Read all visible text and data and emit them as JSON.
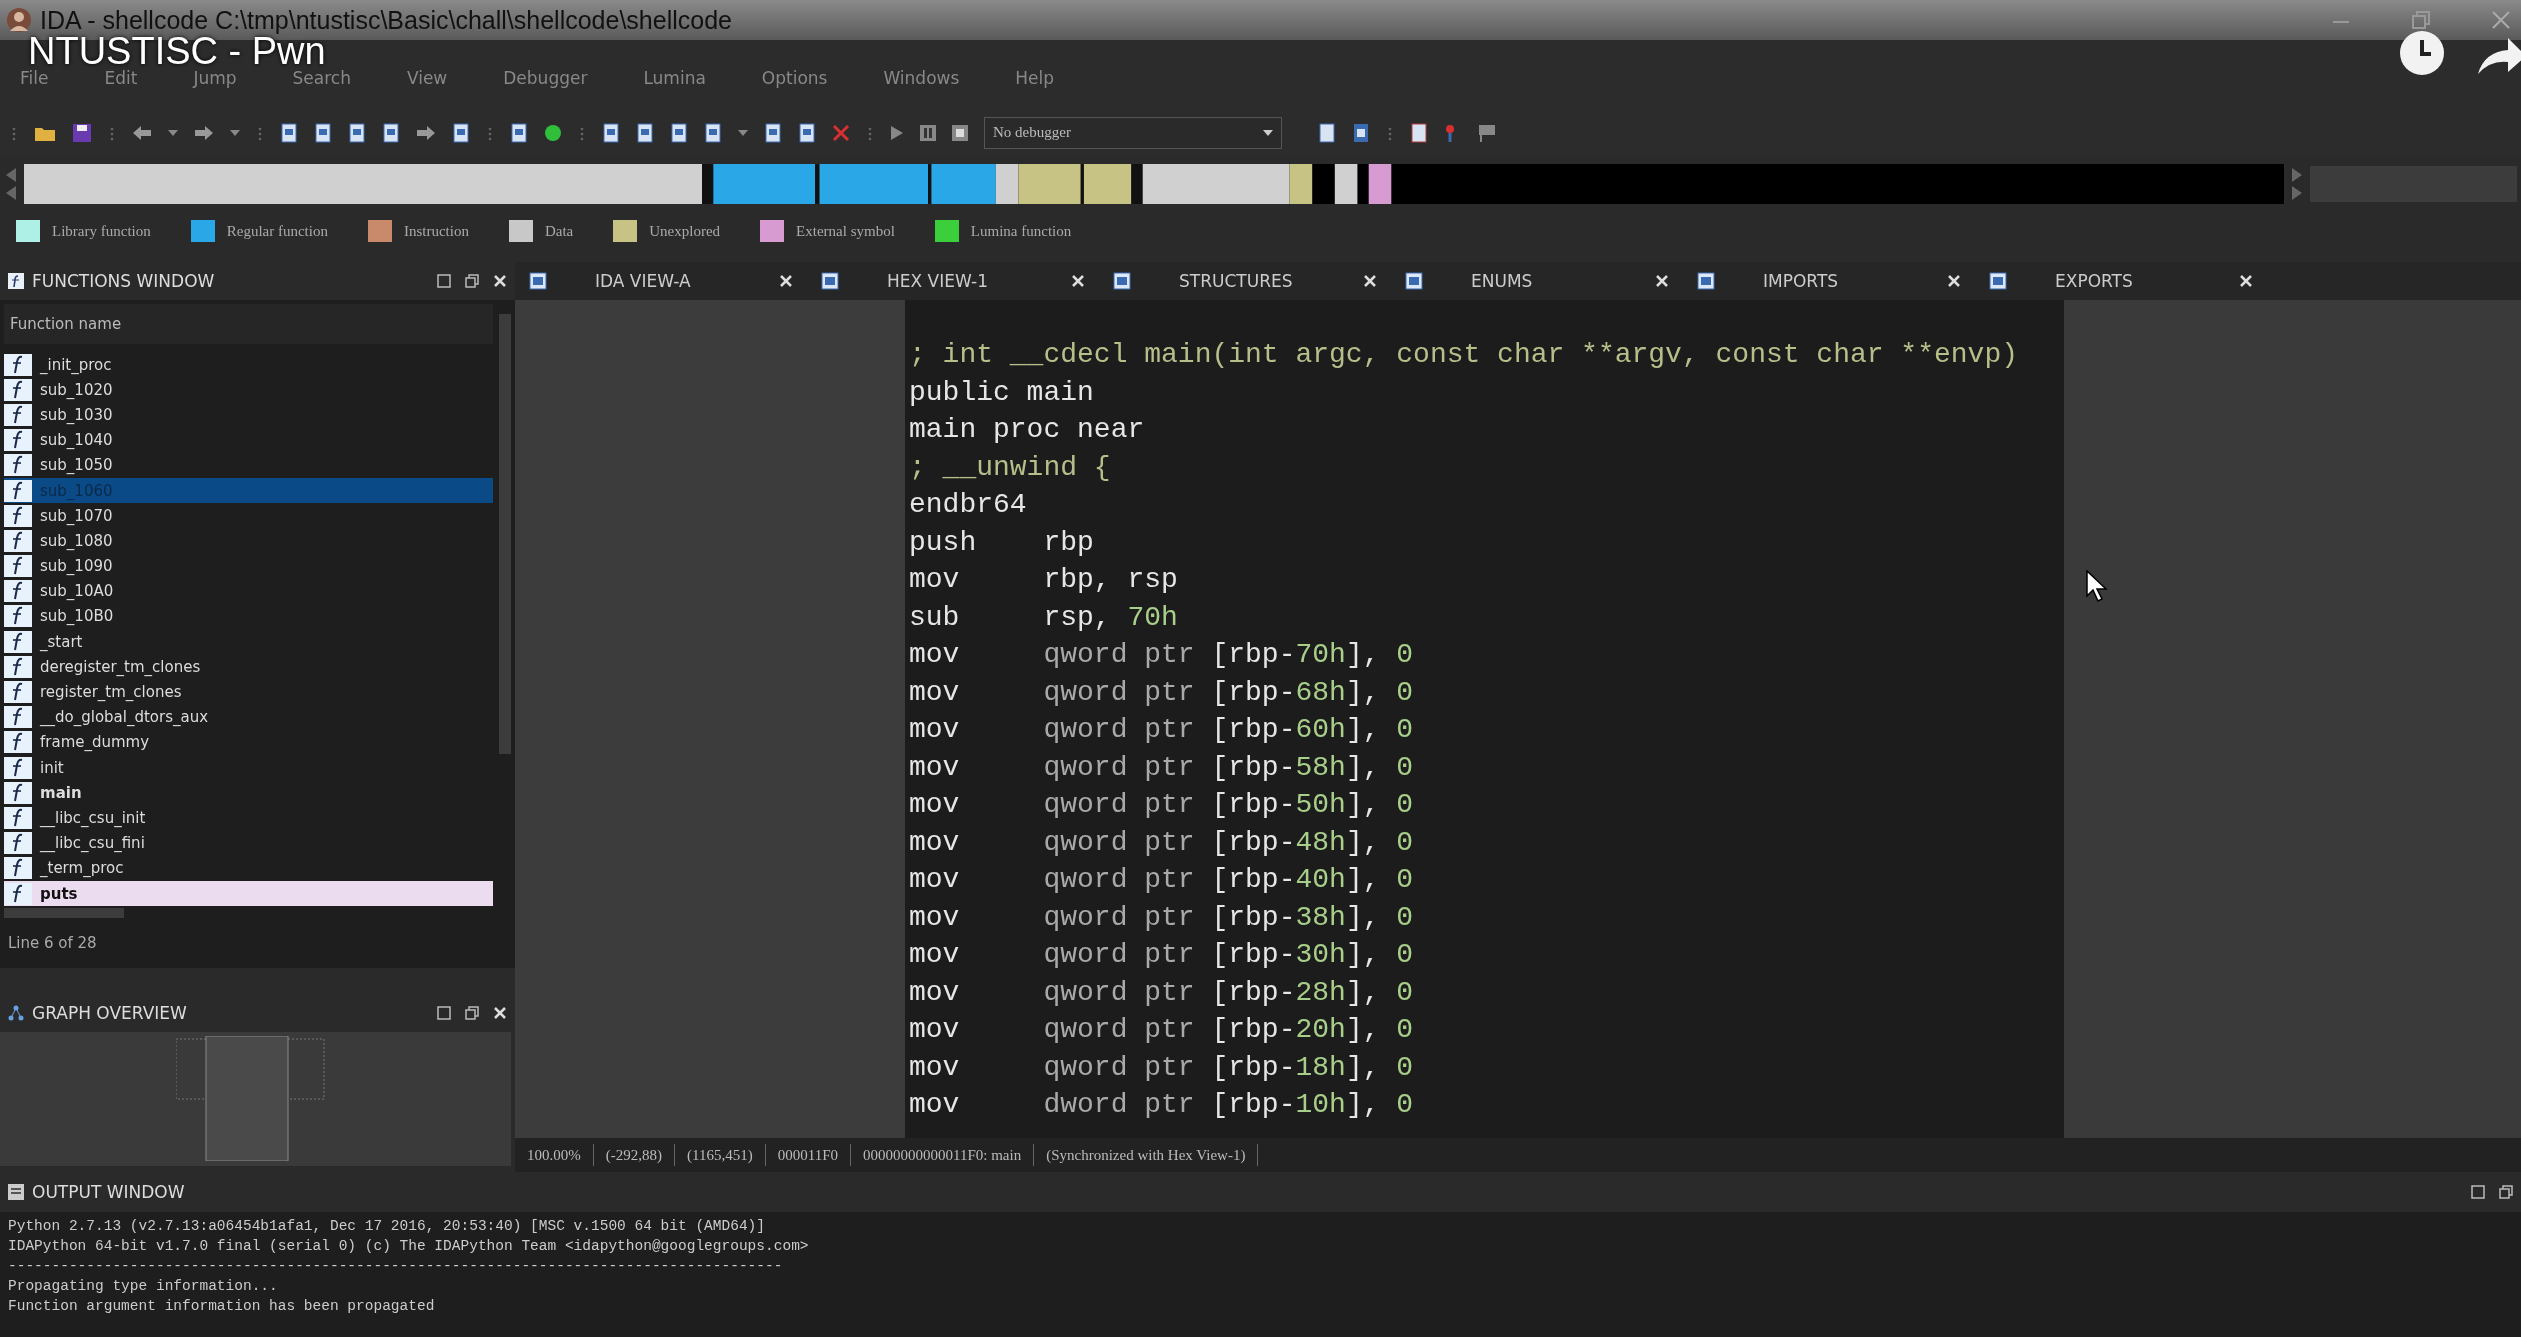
{
  "window": {
    "title": "IDA - shellcode C:\\tmp\\ntustisc\\Basic\\chall\\shellcode\\shellcode"
  },
  "video_overlay": {
    "title": "NTUSTISC - Pwn"
  },
  "menu": [
    "File",
    "Edit",
    "Jump",
    "Search",
    "View",
    "Debugger",
    "Lumina",
    "Options",
    "Windows",
    "Help"
  ],
  "debugger_select": {
    "value": "No debugger"
  },
  "legend": [
    {
      "label": "Library function",
      "color": "#aef0e6"
    },
    {
      "label": "Regular function",
      "color": "#29a7e6"
    },
    {
      "label": "Instruction",
      "color": "#c98a6c"
    },
    {
      "label": "Data",
      "color": "#c8c8c8"
    },
    {
      "label": "Unexplored",
      "color": "#c7c385"
    },
    {
      "label": "External symbol",
      "color": "#d79bd2"
    },
    {
      "label": "Lumina function",
      "color": "#3ccf3c"
    }
  ],
  "functions_window": {
    "title": "FUNCTIONS WINDOW",
    "column": "Function name",
    "status": "Line 6 of 28",
    "items": [
      {
        "name": "_init_proc",
        "selected": false,
        "bold": false
      },
      {
        "name": "sub_1020",
        "selected": false,
        "bold": false
      },
      {
        "name": "sub_1030",
        "selected": false,
        "bold": false
      },
      {
        "name": "sub_1040",
        "selected": false,
        "bold": false
      },
      {
        "name": "sub_1050",
        "selected": false,
        "bold": false
      },
      {
        "name": "sub_1060",
        "selected": true,
        "bold": false
      },
      {
        "name": "sub_1070",
        "selected": false,
        "bold": false
      },
      {
        "name": "sub_1080",
        "selected": false,
        "bold": false
      },
      {
        "name": "sub_1090",
        "selected": false,
        "bold": false
      },
      {
        "name": "sub_10A0",
        "selected": false,
        "bold": false
      },
      {
        "name": "sub_10B0",
        "selected": false,
        "bold": false
      },
      {
        "name": "_start",
        "selected": false,
        "bold": false
      },
      {
        "name": "deregister_tm_clones",
        "selected": false,
        "bold": false
      },
      {
        "name": "register_tm_clones",
        "selected": false,
        "bold": false
      },
      {
        "name": "__do_global_dtors_aux",
        "selected": false,
        "bold": false
      },
      {
        "name": "frame_dummy",
        "selected": false,
        "bold": false
      },
      {
        "name": "init",
        "selected": false,
        "bold": false
      },
      {
        "name": "main",
        "selected": false,
        "bold": true
      },
      {
        "name": "__libc_csu_init",
        "selected": false,
        "bold": false
      },
      {
        "name": "__libc_csu_fini",
        "selected": false,
        "bold": false
      },
      {
        "name": "_term_proc",
        "selected": false,
        "bold": false
      },
      {
        "name": "puts",
        "selected": false,
        "bold": true,
        "color": "#ecdcef"
      }
    ]
  },
  "graph_overview": {
    "title": "GRAPH OVERVIEW"
  },
  "tabs": [
    {
      "label": "IDA VIEW-A"
    },
    {
      "label": "HEX VIEW-1"
    },
    {
      "label": "STRUCTURES"
    },
    {
      "label": "ENUMS"
    },
    {
      "label": "IMPORTS"
    },
    {
      "label": "EXPORTS"
    }
  ],
  "disassembly": [
    {
      "kind": "comment",
      "text": "; int __cdecl main(int argc, const char **argv, const char **envp)"
    },
    {
      "kind": "plain",
      "text": "public main"
    },
    {
      "kind": "plain",
      "text": "main proc near"
    },
    {
      "kind": "comment",
      "text": "; __unwind {"
    },
    {
      "kind": "plain",
      "text": "endbr64"
    },
    {
      "kind": "instr",
      "mnemonic": "push",
      "operands": [
        {
          "kind": "text",
          "text": "rbp"
        }
      ]
    },
    {
      "kind": "instr",
      "mnemonic": "mov",
      "operands": [
        {
          "kind": "text",
          "text": "rbp, rsp"
        }
      ]
    },
    {
      "kind": "instr",
      "mnemonic": "sub",
      "operands": [
        {
          "kind": "text",
          "text": "rsp, "
        },
        {
          "kind": "number",
          "text": "70h"
        }
      ]
    },
    {
      "kind": "instr",
      "mnemonic": "mov",
      "operands": [
        {
          "kind": "keyword",
          "text": "qword ptr "
        },
        {
          "kind": "text",
          "text": "[rbp-"
        },
        {
          "kind": "number",
          "text": "70h"
        },
        {
          "kind": "text",
          "text": "], "
        },
        {
          "kind": "number",
          "text": "0"
        }
      ]
    },
    {
      "kind": "instr",
      "mnemonic": "mov",
      "operands": [
        {
          "kind": "keyword",
          "text": "qword ptr "
        },
        {
          "kind": "text",
          "text": "[rbp-"
        },
        {
          "kind": "number",
          "text": "68h"
        },
        {
          "kind": "text",
          "text": "], "
        },
        {
          "kind": "number",
          "text": "0"
        }
      ]
    },
    {
      "kind": "instr",
      "mnemonic": "mov",
      "operands": [
        {
          "kind": "keyword",
          "text": "qword ptr "
        },
        {
          "kind": "text",
          "text": "[rbp-"
        },
        {
          "kind": "number",
          "text": "60h"
        },
        {
          "kind": "text",
          "text": "], "
        },
        {
          "kind": "number",
          "text": "0"
        }
      ]
    },
    {
      "kind": "instr",
      "mnemonic": "mov",
      "operands": [
        {
          "kind": "keyword",
          "text": "qword ptr "
        },
        {
          "kind": "text",
          "text": "[rbp-"
        },
        {
          "kind": "number",
          "text": "58h"
        },
        {
          "kind": "text",
          "text": "], "
        },
        {
          "kind": "number",
          "text": "0"
        }
      ]
    },
    {
      "kind": "instr",
      "mnemonic": "mov",
      "operands": [
        {
          "kind": "keyword",
          "text": "qword ptr "
        },
        {
          "kind": "text",
          "text": "[rbp-"
        },
        {
          "kind": "number",
          "text": "50h"
        },
        {
          "kind": "text",
          "text": "], "
        },
        {
          "kind": "number",
          "text": "0"
        }
      ]
    },
    {
      "kind": "instr",
      "mnemonic": "mov",
      "operands": [
        {
          "kind": "keyword",
          "text": "qword ptr "
        },
        {
          "kind": "text",
          "text": "[rbp-"
        },
        {
          "kind": "number",
          "text": "48h"
        },
        {
          "kind": "text",
          "text": "], "
        },
        {
          "kind": "number",
          "text": "0"
        }
      ]
    },
    {
      "kind": "instr",
      "mnemonic": "mov",
      "operands": [
        {
          "kind": "keyword",
          "text": "qword ptr "
        },
        {
          "kind": "text",
          "text": "[rbp-"
        },
        {
          "kind": "number",
          "text": "40h"
        },
        {
          "kind": "text",
          "text": "], "
        },
        {
          "kind": "number",
          "text": "0"
        }
      ]
    },
    {
      "kind": "instr",
      "mnemonic": "mov",
      "operands": [
        {
          "kind": "keyword",
          "text": "qword ptr "
        },
        {
          "kind": "text",
          "text": "[rbp-"
        },
        {
          "kind": "number",
          "text": "38h"
        },
        {
          "kind": "text",
          "text": "], "
        },
        {
          "kind": "number",
          "text": "0"
        }
      ]
    },
    {
      "kind": "instr",
      "mnemonic": "mov",
      "operands": [
        {
          "kind": "keyword",
          "text": "qword ptr "
        },
        {
          "kind": "text",
          "text": "[rbp-"
        },
        {
          "kind": "number",
          "text": "30h"
        },
        {
          "kind": "text",
          "text": "], "
        },
        {
          "kind": "number",
          "text": "0"
        }
      ]
    },
    {
      "kind": "instr",
      "mnemonic": "mov",
      "operands": [
        {
          "kind": "keyword",
          "text": "qword ptr "
        },
        {
          "kind": "text",
          "text": "[rbp-"
        },
        {
          "kind": "number",
          "text": "28h"
        },
        {
          "kind": "text",
          "text": "], "
        },
        {
          "kind": "number",
          "text": "0"
        }
      ]
    },
    {
      "kind": "instr",
      "mnemonic": "mov",
      "operands": [
        {
          "kind": "keyword",
          "text": "qword ptr "
        },
        {
          "kind": "text",
          "text": "[rbp-"
        },
        {
          "kind": "number",
          "text": "20h"
        },
        {
          "kind": "text",
          "text": "], "
        },
        {
          "kind": "number",
          "text": "0"
        }
      ]
    },
    {
      "kind": "instr",
      "mnemonic": "mov",
      "operands": [
        {
          "kind": "keyword",
          "text": "qword ptr "
        },
        {
          "kind": "text",
          "text": "[rbp-"
        },
        {
          "kind": "number",
          "text": "18h"
        },
        {
          "kind": "text",
          "text": "], "
        },
        {
          "kind": "number",
          "text": "0"
        }
      ]
    },
    {
      "kind": "instr",
      "mnemonic": "mov",
      "operands": [
        {
          "kind": "keyword",
          "text": "dword ptr "
        },
        {
          "kind": "text",
          "text": "[rbp-"
        },
        {
          "kind": "number",
          "text": "10h"
        },
        {
          "kind": "text",
          "text": "], "
        },
        {
          "kind": "number",
          "text": "0"
        }
      ]
    }
  ],
  "status_bar": [
    "100.00%",
    "(-292,88)",
    "(1165,451)",
    "000011F0",
    "00000000000011F0: main",
    "(Synchronized with Hex View-1)"
  ],
  "output_window": {
    "title": "OUTPUT WINDOW",
    "lines": [
      "Python 2.7.13 (v2.7.13:a06454b1afa1, Dec 17 2016, 20:53:40) [MSC v.1500 64 bit (AMD64)]",
      "IDAPython 64-bit v1.7.0 final (serial 0) (c) The IDAPython Team <idapython@googlegroups.com>",
      "-----------------------------------------------------------------------------------------",
      "Propagating type information...",
      "Function argument information has been propagated"
    ]
  }
}
